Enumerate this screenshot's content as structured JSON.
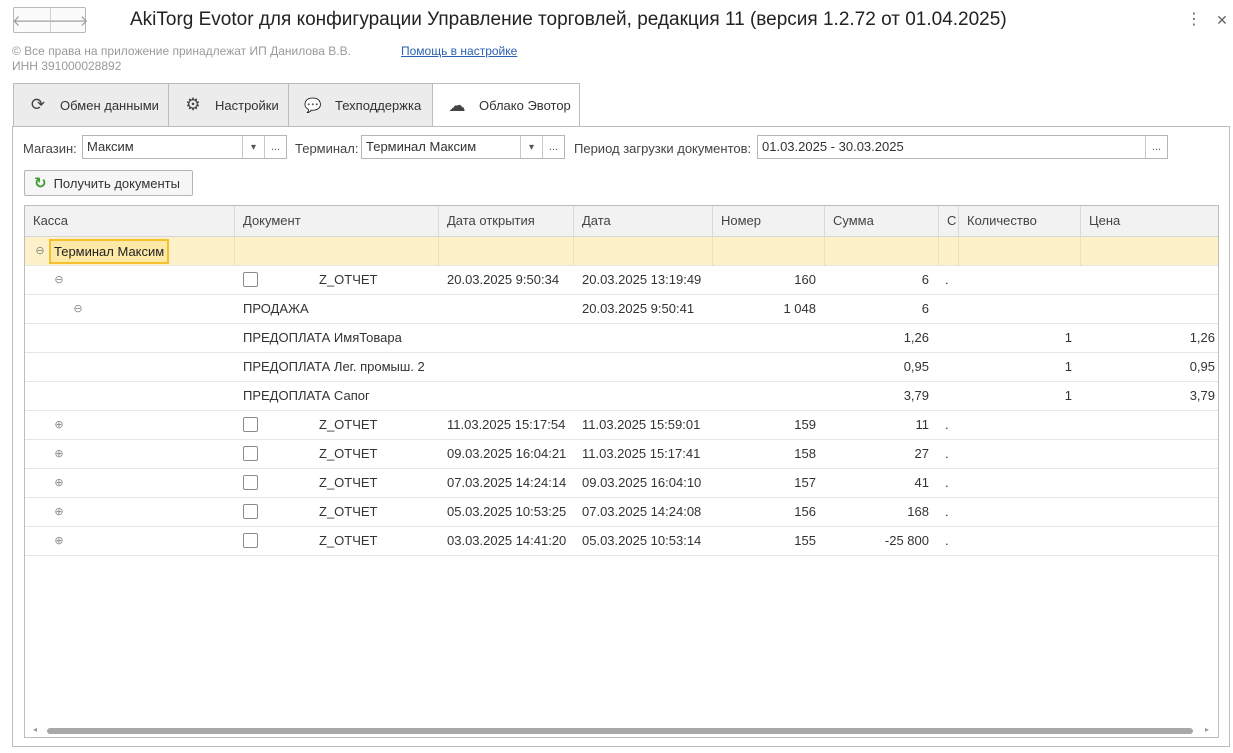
{
  "window": {
    "title": "AkiTorg Evotor для конфигурации Управление торговлей, редакция 11 (версия 1.2.72 от 01.04.2025)",
    "back_icon": "arrow-left-icon",
    "forward_icon": "arrow-right-icon",
    "menu_glyph": "⋮",
    "close_glyph": "✕",
    "back_glyph": "🡐",
    "forward_glyph": "🡒"
  },
  "header": {
    "copyright": "© Все права на приложение принадлежат ИП Данилова В.В.",
    "inn": "ИНН 391000028892",
    "help_link": "Помощь в настройке"
  },
  "tabs": [
    {
      "label": "Обмен данными",
      "icon": "refresh-icon",
      "glyph": "⟳"
    },
    {
      "label": "Настройки",
      "icon": "gear-icon",
      "glyph": "⚙"
    },
    {
      "label": "Техподдержка",
      "icon": "chat-icon",
      "glyph": "💬"
    },
    {
      "label": "Облако Эвотор",
      "icon": "cloud-icon",
      "glyph": "☁"
    }
  ],
  "active_tab": 3,
  "filters": {
    "store_label": "Магазин:",
    "store_value": "Максим",
    "terminal_label": "Терминал:",
    "terminal_value": "Терминал Максим",
    "period_label": "Период загрузки документов:",
    "period_value": "01.03.2025 - 30.03.2025",
    "dropdown_glyph": "▾",
    "dots_glyph": "..."
  },
  "actions": {
    "get_documents": "Получить документы",
    "get_documents_icon": "refresh-icon",
    "get_documents_glyph": "↻"
  },
  "table": {
    "columns": [
      "Касса",
      "Документ",
      "Дата открытия",
      "Дата",
      "Номер",
      "Сумма",
      "С",
      "Количество",
      "Цена"
    ],
    "group_label": "Терминал Максим",
    "collapse_glyph": "⊖",
    "expand_glyph": "⊕",
    "rows": [
      {
        "kind": "z_open",
        "doc": "Z_ОТЧЕТ",
        "opened": "20.03.2025 9:50:34",
        "date": "20.03.2025 13:19:49",
        "number": "160",
        "sum": "6",
        "s": "."
      },
      {
        "kind": "sale",
        "doc": "ПРОДАЖА",
        "opened": "",
        "date": "20.03.2025 9:50:41",
        "number": "1 048",
        "sum": "6",
        "s": ""
      },
      {
        "kind": "item",
        "doc": "ПРЕДОПЛАТА ИмяТовара",
        "sum": "1,26",
        "qty": "1",
        "price": "1,26"
      },
      {
        "kind": "item",
        "doc": "ПРЕДОПЛАТА Лег. промыш. 2",
        "sum": "0,95",
        "qty": "1",
        "price": "0,95"
      },
      {
        "kind": "item",
        "doc": "ПРЕДОПЛАТА Сапог",
        "sum": "3,79",
        "qty": "1",
        "price": "3,79"
      },
      {
        "kind": "z",
        "doc": "Z_ОТЧЕТ",
        "opened": "11.03.2025 15:17:54",
        "date": "11.03.2025 15:59:01",
        "number": "159",
        "sum": "11",
        "s": "."
      },
      {
        "kind": "z",
        "doc": "Z_ОТЧЕТ",
        "opened": "09.03.2025 16:04:21",
        "date": "11.03.2025 15:17:41",
        "number": "158",
        "sum": "27",
        "s": "."
      },
      {
        "kind": "z",
        "doc": "Z_ОТЧЕТ",
        "opened": "07.03.2025 14:24:14",
        "date": "09.03.2025 16:04:10",
        "number": "157",
        "sum": "41",
        "s": "."
      },
      {
        "kind": "z",
        "doc": "Z_ОТЧЕТ",
        "opened": "05.03.2025 10:53:25",
        "date": "07.03.2025 14:24:08",
        "number": "156",
        "sum": "168",
        "s": "."
      },
      {
        "kind": "z",
        "doc": "Z_ОТЧЕТ",
        "opened": "03.03.2025 14:41:20",
        "date": "05.03.2025 10:53:14",
        "number": "155",
        "sum": "-25 800",
        "s": "."
      }
    ]
  },
  "scrollbar": {
    "left_glyph": "◂",
    "right_glyph": "▸"
  }
}
